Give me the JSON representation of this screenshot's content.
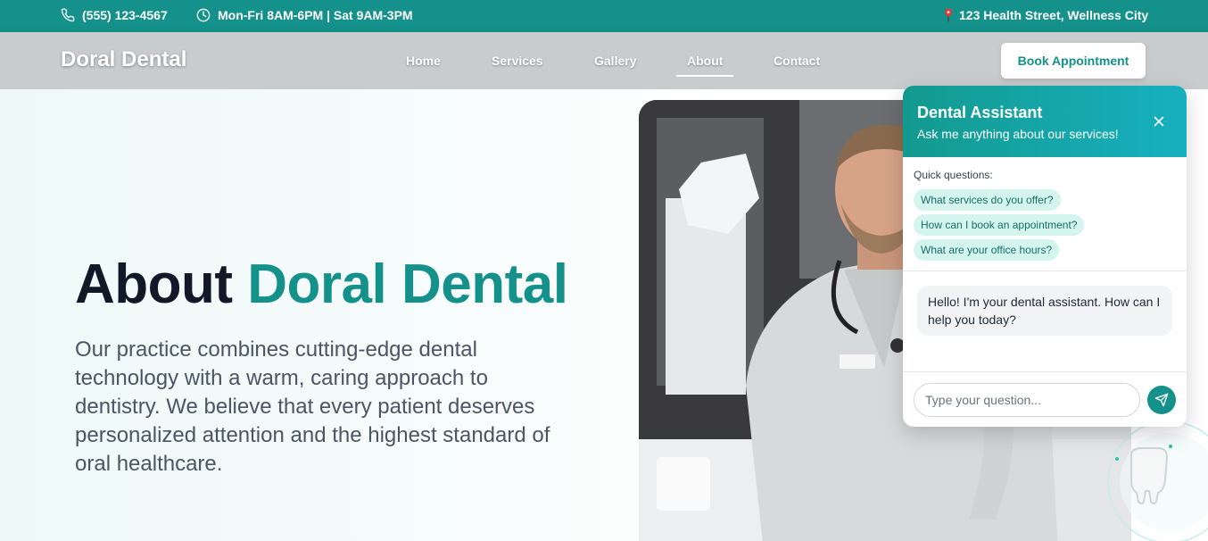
{
  "topbar": {
    "phone": "(555) 123-4567",
    "hours": "Mon-Fri 8AM-6PM | Sat 9AM-3PM",
    "address": "123 Health Street, Wellness City",
    "phone_icon": "phone-icon",
    "clock_icon": "clock-icon",
    "pin_icon": "map-pin-icon"
  },
  "nav": {
    "brand": "Doral Dental",
    "links": [
      "Home",
      "Services",
      "Gallery",
      "About",
      "Contact"
    ],
    "active": "About",
    "cta": "Book Appointment"
  },
  "hero": {
    "title_plain": "About",
    "title_accent": "Doral Dental",
    "description": "Our practice combines cutting-edge dental technology with a warm, caring approach to dentistry. We believe that every patient deserves personalized attention and the highest standard of oral healthcare."
  },
  "chat": {
    "title": "Dental Assistant",
    "subtitle": "Ask me anything about our services!",
    "quick_label": "Quick questions:",
    "quick_questions": [
      "What services do you offer?",
      "How can I book an appointment?",
      "What are your office hours?"
    ],
    "greeting": "Hello! I'm your dental assistant. How can I help you today?",
    "input_placeholder": "Type your question...",
    "close_icon": "close-icon",
    "send_icon": "send-icon"
  },
  "colors": {
    "brand": "#14918a",
    "chip_bg": "#d4f4ee",
    "title_dark": "#111827"
  }
}
